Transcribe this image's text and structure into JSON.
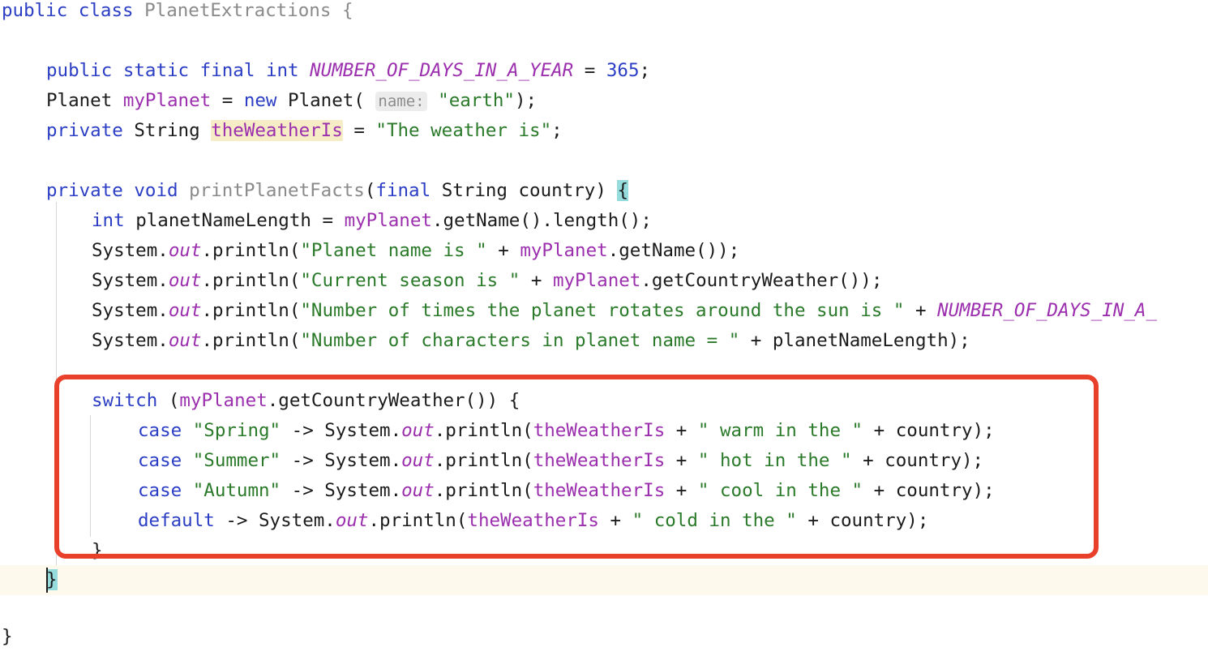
{
  "editor": {
    "language": "java",
    "class_name": "PlanetExtractions",
    "theme": "light",
    "colors": {
      "background": "#ffffff",
      "keyword": "#2b3ec4",
      "string": "#2a7a2a",
      "field": "#9b2fae",
      "class_declaration": "#8a8a8a",
      "plain_text": "#1b1b1b",
      "number": "#2b3ec4",
      "identifier_highlight": "#f6ecc6",
      "brace_match_highlight": "#96dcdc",
      "caret_line": "#fdf9ec",
      "param_hint_bg": "#ececec",
      "param_hint_text": "#8c8c8c",
      "annotation_red": "#e8402a",
      "indent_guide": "#d6d6d6"
    }
  },
  "code": {
    "line_01": {
      "kw_public": "public",
      "kw_class": "class",
      "class_name": "PlanetExtractions",
      "brace": "{"
    },
    "line_03": {
      "kw_public": "public",
      "kw_static": "static",
      "kw_final": "final",
      "kw_int": "int",
      "const_name": "NUMBER_OF_DAYS_IN_A_YEAR",
      "eq": "=",
      "value": "365",
      "semi": ";"
    },
    "line_04": {
      "type": "Planet",
      "field": "myPlanet",
      "eq": "=",
      "kw_new": "new",
      "ctor": "Planet(",
      "param_hint": "name:",
      "arg": "\"earth\"",
      "tail": ");"
    },
    "line_05": {
      "kw_private": "private",
      "type": "String",
      "field": "theWeatherIs",
      "eq": "=",
      "value": "\"The weather is\"",
      "semi": ";"
    },
    "line_07": {
      "kw_private": "private",
      "kw_void": "void",
      "method": "printPlanetFacts",
      "open_paren": "(",
      "kw_final": "final",
      "param_type": "String",
      "param_name": "country",
      "close_paren": ")",
      "brace": "{"
    },
    "line_08": {
      "kw_int": "int",
      "var": "planetNameLength",
      "eq": "=",
      "field": "myPlanet",
      "call": ".getName().length();"
    },
    "line_09": {
      "sys": "System.",
      "out": "out",
      "println": ".println(",
      "str": "\"Planet name is \"",
      "plus": " + ",
      "field": "myPlanet",
      "tail": ".getName());"
    },
    "line_10": {
      "sys": "System.",
      "out": "out",
      "println": ".println(",
      "str": "\"Current season is \"",
      "plus": " + ",
      "field": "myPlanet",
      "tail": ".getCountryWeather());"
    },
    "line_11": {
      "sys": "System.",
      "out": "out",
      "println": ".println(",
      "str": "\"Number of times the planet rotates around the sun is \"",
      "plus": " + ",
      "const_name": "NUMBER_OF_DAYS_IN_A_",
      "clipped": true
    },
    "line_12": {
      "sys": "System.",
      "out": "out",
      "println": ".println(",
      "str": "\"Number of characters in planet name = \"",
      "plus": " + ",
      "var": "planetNameLength",
      "tail": ");"
    },
    "line_14": {
      "kw_switch": "switch",
      "open": " (",
      "field": "myPlanet",
      "call": ".getCountryWeather()) {"
    },
    "line_15": {
      "kw_case": "case",
      "label": "\"Spring\"",
      "arrow": " -> ",
      "sys": "System.",
      "out": "out",
      "println": ".println(",
      "field": "theWeatherIs",
      "plus": " + ",
      "str": "\" warm in the \"",
      "plus2": " + ",
      "arg": "country",
      "tail": ");"
    },
    "line_16": {
      "kw_case": "case",
      "label": "\"Summer\"",
      "arrow": " -> ",
      "sys": "System.",
      "out": "out",
      "println": ".println(",
      "field": "theWeatherIs",
      "plus": " + ",
      "str": "\" hot in the \"",
      "plus2": " + ",
      "arg": "country",
      "tail": ");"
    },
    "line_17": {
      "kw_case": "case",
      "label": "\"Autumn\"",
      "arrow": " -> ",
      "sys": "System.",
      "out": "out",
      "println": ".println(",
      "field": "theWeatherIs",
      "plus": " + ",
      "str": "\" cool in the \"",
      "plus2": " + ",
      "arg": "country",
      "tail": ");"
    },
    "line_18": {
      "kw_default": "default",
      "arrow": " -> ",
      "sys": "System.",
      "out": "out",
      "println": ".println(",
      "field": "theWeatherIs",
      "plus": " + ",
      "str": "\" cold in the \"",
      "plus2": " + ",
      "arg": "country",
      "tail": ");"
    },
    "line_19": {
      "brace": "}"
    },
    "line_20": {
      "brace": "}"
    },
    "line_22": {
      "brace": "}"
    }
  },
  "annotation": {
    "shape": "rounded-rectangle",
    "color": "#e8402a",
    "covers": "switch statement block"
  }
}
